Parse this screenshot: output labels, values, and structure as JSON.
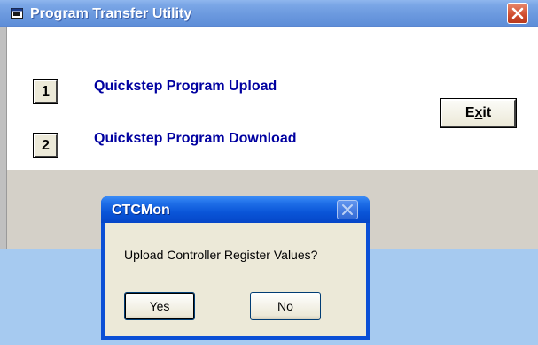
{
  "main_window": {
    "title": "Program Transfer Utility",
    "options": [
      {
        "key": "1",
        "label": "Quickstep Program Upload"
      },
      {
        "key": "2",
        "label": "Quickstep Program Download"
      }
    ],
    "exit_button": {
      "prefix": "E",
      "underlined": "x",
      "suffix": "it"
    }
  },
  "dialog": {
    "title": "CTCMon",
    "message": "Upload Controller Register Values?",
    "yes_label": "Yes",
    "no_label": "No"
  },
  "colors": {
    "option_text": "#0000a0",
    "titlebar_inactive": "#7aa6e6",
    "titlebar_active": "#0a55d8",
    "desktop": "#a6caf0"
  }
}
